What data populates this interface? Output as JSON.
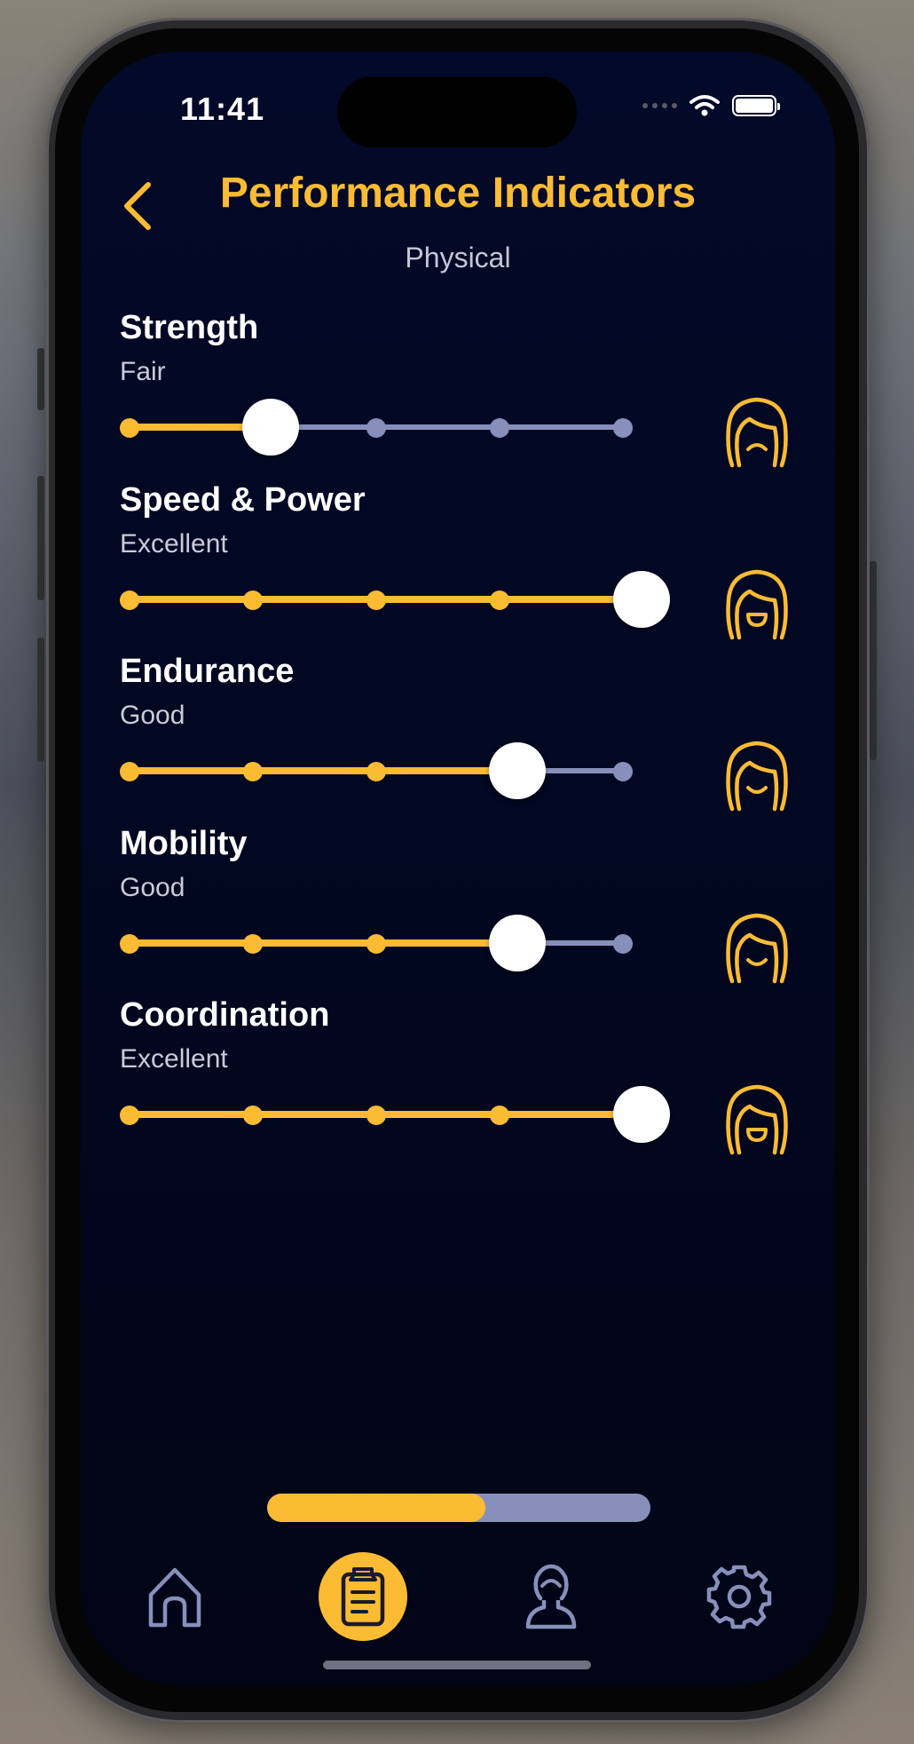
{
  "status": {
    "time": "11:41"
  },
  "header": {
    "title": "Performance Indicators",
    "subtitle": "Physical"
  },
  "colors": {
    "accent": "#fbbb33",
    "track_inactive": "#8790bb",
    "background": "#030928"
  },
  "indicators": [
    {
      "name": "Strength",
      "rating": "Fair",
      "level": 2,
      "max": 5,
      "face": "frown-face-icon"
    },
    {
      "name": "Speed & Power",
      "rating": "Excellent",
      "level": 5,
      "max": 5,
      "face": "grin-face-icon"
    },
    {
      "name": "Endurance",
      "rating": "Good",
      "level": 4,
      "max": 5,
      "face": "smile-face-icon"
    },
    {
      "name": "Mobility",
      "rating": "Good",
      "level": 4,
      "max": 5,
      "face": "smile-face-icon"
    },
    {
      "name": "Coordination",
      "rating": "Excellent",
      "level": 5,
      "max": 5,
      "face": "grin-face-icon"
    }
  ],
  "progress": {
    "fraction": 0.57
  },
  "tabs": [
    {
      "name": "home",
      "icon": "home-icon",
      "active": false
    },
    {
      "name": "assessment",
      "icon": "clipboard-icon",
      "active": true
    },
    {
      "name": "profile",
      "icon": "person-icon",
      "active": false
    },
    {
      "name": "settings",
      "icon": "gear-icon",
      "active": false
    }
  ]
}
